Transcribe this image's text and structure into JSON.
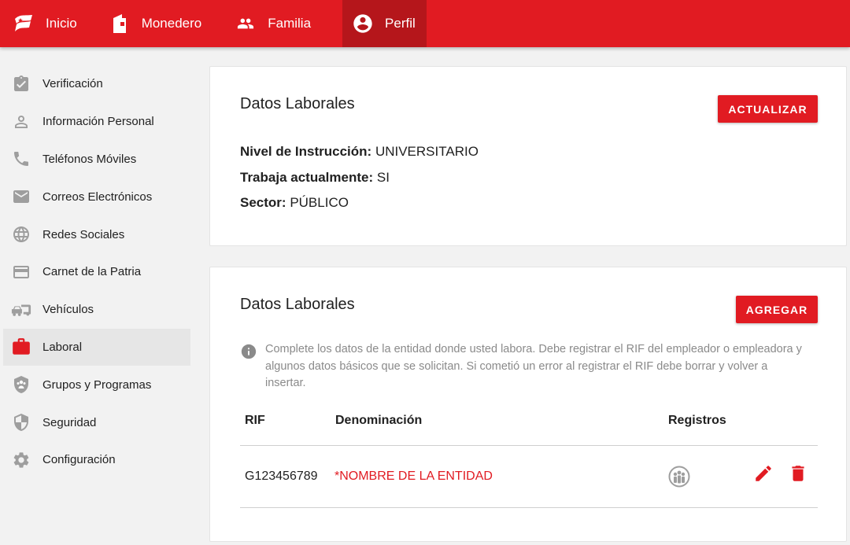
{
  "topnav": {
    "items": [
      {
        "label": "Inicio",
        "icon": "flag-icon"
      },
      {
        "label": "Monedero",
        "icon": "wallet-icon"
      },
      {
        "label": "Familia",
        "icon": "people-icon"
      },
      {
        "label": "Perfil",
        "icon": "account-circle-icon",
        "active": true
      }
    ]
  },
  "sidebar": {
    "items": [
      {
        "label": "Verificación",
        "icon": "clipboard-check-icon"
      },
      {
        "label": "Información Personal",
        "icon": "person-icon"
      },
      {
        "label": "Teléfonos Móviles",
        "icon": "phone-icon"
      },
      {
        "label": "Correos Electrónicos",
        "icon": "mail-icon"
      },
      {
        "label": "Redes Sociales",
        "icon": "globe-icon"
      },
      {
        "label": "Carnet de la Patria",
        "icon": "card-icon"
      },
      {
        "label": "Vehículos",
        "icon": "vehicles-icon"
      },
      {
        "label": "Laboral",
        "icon": "briefcase-icon",
        "active": true
      },
      {
        "label": "Grupos y Programas",
        "icon": "group-shield-icon"
      },
      {
        "label": "Seguridad",
        "icon": "shield-icon"
      },
      {
        "label": "Configuración",
        "icon": "gear-icon"
      }
    ]
  },
  "card1": {
    "title": "Datos Laborales",
    "button": "ACTUALIZAR",
    "fields": [
      {
        "label": "Nivel de Instrucción:",
        "value": "UNIVERSITARIO"
      },
      {
        "label": "Trabaja actualmente:",
        "value": "SI"
      },
      {
        "label": "Sector:",
        "value": "PÚBLICO"
      }
    ]
  },
  "card2": {
    "title": "Datos Laborales",
    "button": "AGREGAR",
    "info": "Complete los datos de la entidad donde usted labora. Debe registrar el RIF del empleador o empleadora y algunos datos básicos que se solicitan. Si cometió un error al registrar el RIF debe borrar y volver a insertar.",
    "table": {
      "headers": [
        "RIF",
        "Denominación",
        "Registros"
      ],
      "rows": [
        {
          "rif": "G123456789",
          "denominacion": "*NOMBRE DE LA ENTIDAD"
        }
      ]
    }
  },
  "colors": {
    "brand": "#e11b22",
    "brand_dark": "#b5161b"
  }
}
